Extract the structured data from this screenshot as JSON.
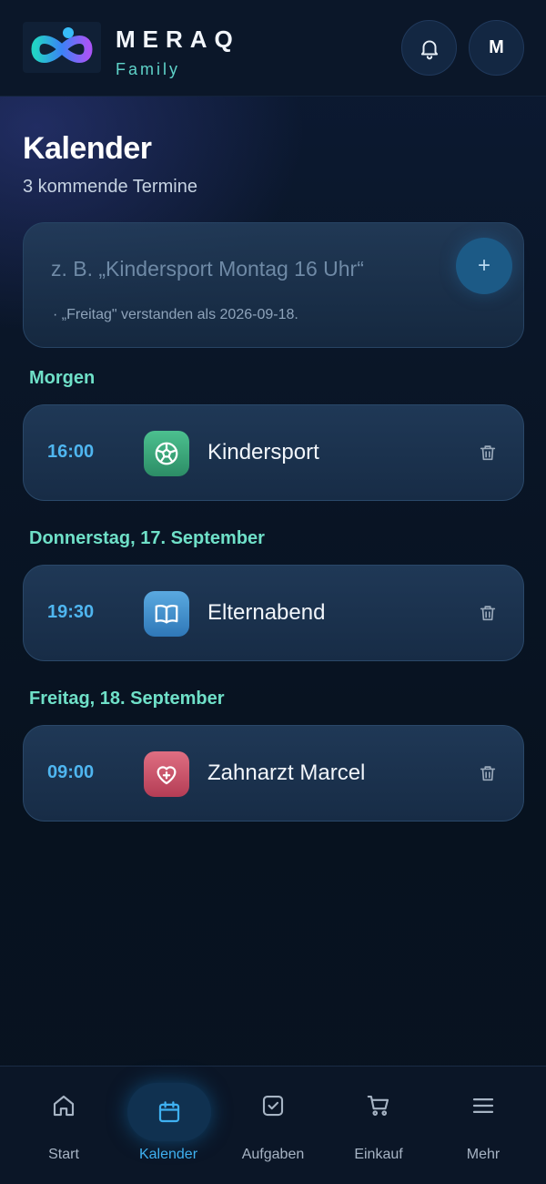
{
  "header": {
    "brand_name": "MERAQ",
    "brand_sub": "Family",
    "avatar_initial": "M",
    "icons": {
      "logo": "infinity-logo-icon",
      "notifications": "bell-icon"
    }
  },
  "page": {
    "title": "Kalender",
    "subtitle": "3 kommende Termine"
  },
  "quick_add": {
    "placeholder": "z. B. „Kindersport Montag 16 Uhr“",
    "value": "",
    "add_label": "+",
    "hint": "· „Freitag\" verstanden als 2026-09-18."
  },
  "sections": [
    {
      "label": "Morgen",
      "events": [
        {
          "time": "16:00",
          "title": "Kindersport",
          "icon": "soccer-ball-icon",
          "icon_color": "#3aa67c"
        }
      ]
    },
    {
      "label": "Donnerstag, 17. September",
      "events": [
        {
          "time": "19:30",
          "title": "Elternabend",
          "icon": "book-icon",
          "icon_color": "#3d8fcf"
        }
      ]
    },
    {
      "label": "Freitag, 18. September",
      "events": [
        {
          "time": "09:00",
          "title": "Zahnarzt Marcel",
          "icon": "heart-plus-icon",
          "icon_color": "#c94d62"
        }
      ]
    }
  ],
  "nav": {
    "items": [
      {
        "label": "Start",
        "icon": "home-icon",
        "active": false
      },
      {
        "label": "Kalender",
        "icon": "calendar-icon",
        "active": true
      },
      {
        "label": "Aufgaben",
        "icon": "checkbox-icon",
        "active": false
      },
      {
        "label": "Einkauf",
        "icon": "cart-icon",
        "active": false
      },
      {
        "label": "Mehr",
        "icon": "menu-icon",
        "active": false
      }
    ]
  },
  "colors": {
    "accent": "#3fb1f1",
    "section_label": "#6fe0c8",
    "background": "#07121f"
  }
}
